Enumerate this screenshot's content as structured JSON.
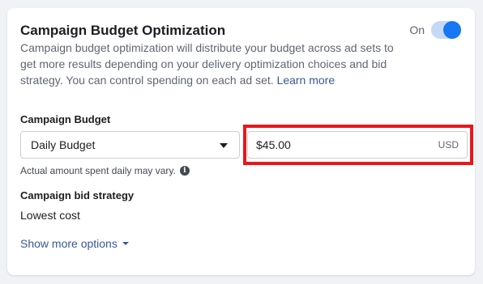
{
  "cbo": {
    "title": "Campaign Budget Optimization",
    "description": "Campaign budget optimization will distribute your budget across ad sets to get more results depending on your delivery optimization choices and bid strategy. You can control spending on each ad set.",
    "learn_more": "Learn more",
    "toggle_label": "On",
    "toggle_on": true
  },
  "budget": {
    "label": "Campaign Budget",
    "type_selected": "Daily Budget",
    "amount": "$45.00",
    "currency": "USD",
    "hint": "Actual amount spent daily may vary.",
    "hint_icon": "info-icon"
  },
  "bid": {
    "label": "Campaign bid strategy",
    "value": "Lowest cost"
  },
  "show_more": "Show more options",
  "colors": {
    "accent": "#1877f2",
    "link": "#385898",
    "highlight": "#e8171b"
  }
}
